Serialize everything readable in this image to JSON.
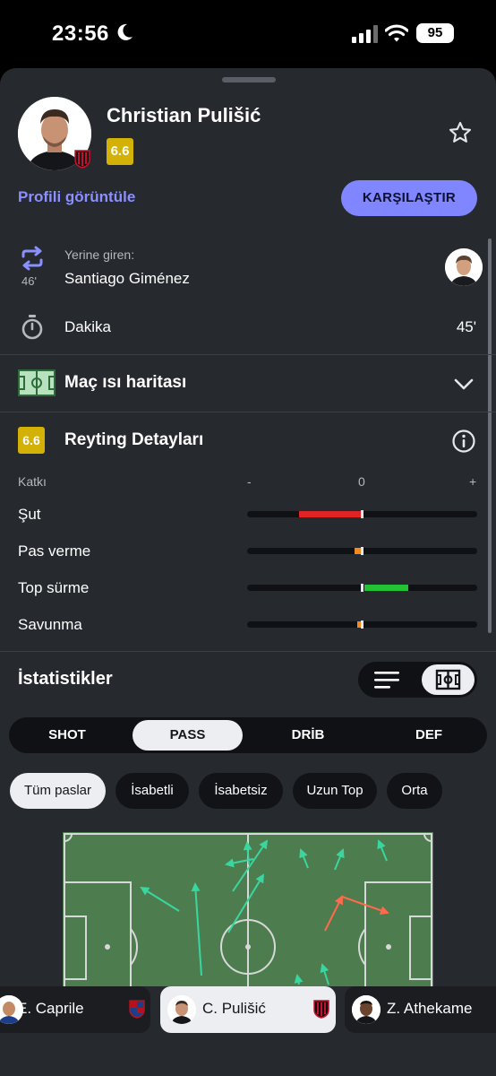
{
  "status_bar": {
    "time": "23:56",
    "battery": "95"
  },
  "player": {
    "name": "Christian Pulišić",
    "rating": "6.6"
  },
  "actions": {
    "profile_link": "Profili görüntüle",
    "compare": "KARŞILAŞTIR"
  },
  "substitution": {
    "label": "Yerine giren:",
    "minute": "46'",
    "name": "Santiago Giménez"
  },
  "minutes": {
    "label": "Dakika",
    "value": "45'"
  },
  "heatmap": {
    "title": "Maç ısı haritası"
  },
  "rating_details": {
    "badge": "6.6",
    "title": "Reyting Detayları",
    "header": {
      "label": "Katkı",
      "minus": "-",
      "zero": "0",
      "plus": "+"
    },
    "metrics": [
      {
        "label": "Şut",
        "value": -0.55,
        "color": "#e02424"
      },
      {
        "label": "Pas verme",
        "value": -0.06,
        "color": "#f08c1e"
      },
      {
        "label": "Top sürme",
        "value": 0.38,
        "color": "#22c234"
      },
      {
        "label": "Savunma",
        "value": -0.04,
        "color": "#f08c1e"
      }
    ]
  },
  "statistics": {
    "title": "İstatistikler",
    "tabs": [
      "SHOT",
      "PASS",
      "DRİB",
      "DEF"
    ],
    "active_tab": "PASS",
    "filters": [
      "Tüm paslar",
      "İsabetli",
      "İsabetsiz",
      "Uzun Top",
      "Orta"
    ],
    "active_filter": "Tüm paslar"
  },
  "player_switcher": [
    {
      "name": "E. Caprile",
      "club": "Cagliari"
    },
    {
      "name": "C. Pulišić",
      "club": "AC Milan"
    },
    {
      "name": "Z. Athekame",
      "club": "AC Milan"
    }
  ],
  "colors": {
    "sheet_bg": "#26292e",
    "accent": "#7f86ff",
    "rating": "#d4b106",
    "pitch": "#4d7d4f",
    "pass_success": "#3ad6a0",
    "pass_fail": "#ff6a4d"
  }
}
